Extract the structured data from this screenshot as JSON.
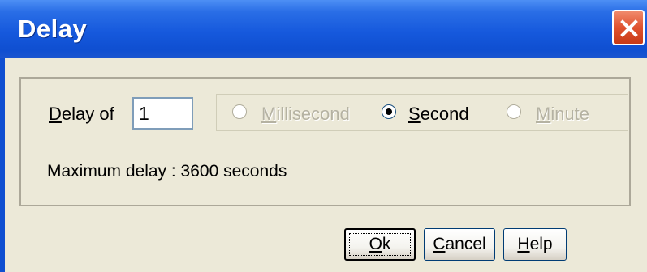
{
  "window": {
    "title": "Delay",
    "close_icon": "close-icon"
  },
  "delay": {
    "label_mnemonic": "D",
    "label_rest": "elay of",
    "value": "1"
  },
  "units": [
    {
      "mnemonic": "M",
      "rest": "illisecond",
      "selected": false,
      "enabled": false
    },
    {
      "mnemonic": "S",
      "rest": "econd",
      "selected": true,
      "enabled": true
    },
    {
      "mnemonic": "M",
      "rest": "inute",
      "selected": false,
      "enabled": false
    }
  ],
  "max_delay_text": "Maximum delay : 3600 seconds",
  "buttons": {
    "ok": {
      "mnemonic": "O",
      "rest": "k"
    },
    "cancel": {
      "mnemonic": "C",
      "rest": "ancel"
    },
    "help": {
      "mnemonic": "H",
      "rest": "elp"
    }
  }
}
